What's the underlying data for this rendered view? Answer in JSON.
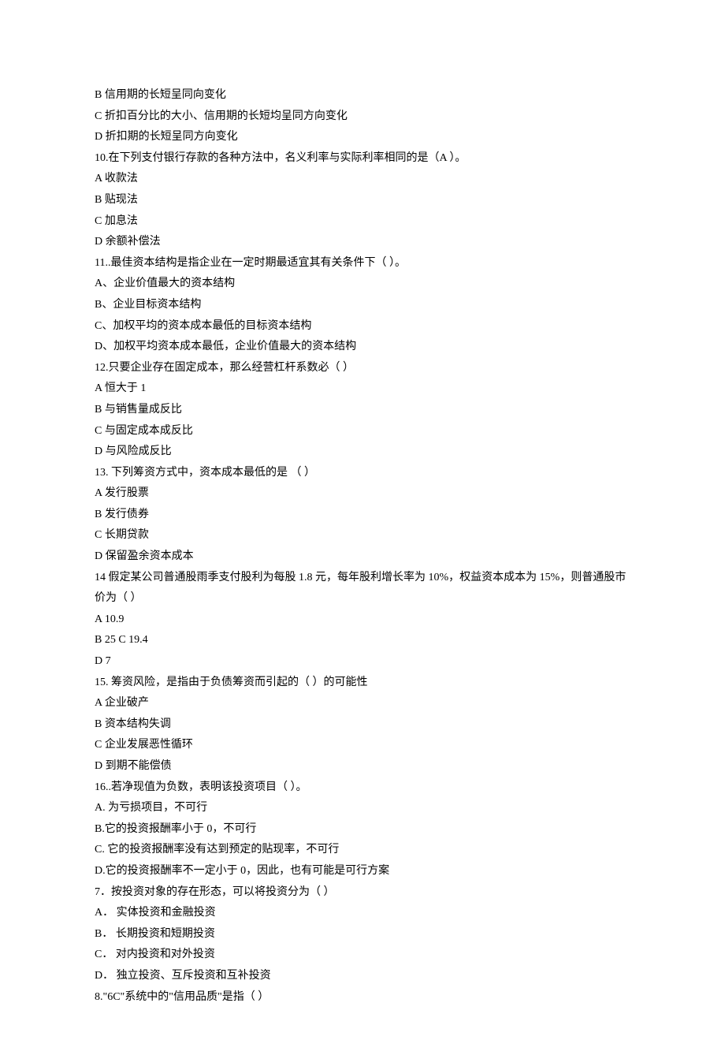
{
  "lines": [
    "B 信用期的长短呈同向变化",
    "C 折扣百分比的大小、信用期的长短均呈同方向变化",
    "D 折扣期的长短呈同方向变化",
    "10.在下列支付银行存款的各种方法中，名义利率与实际利率相同的是（A ）。",
    "A 收款法",
    "B 贴现法",
    "C 加息法",
    "D 余额补偿法",
    "11..最佳资本结构是指企业在一定时期最适宜其有关条件下（ ）。",
    "A、企业价值最大的资本结构",
    "B、企业目标资本结构",
    "C、加权平均的资本成本最低的目标资本结构",
    "D、加权平均资本成本最低，企业价值最大的资本结构",
    "12.只要企业存在固定成本，那么经营杠杆系数必（ ）",
    "A 恒大于 1",
    "B 与销售量成反比",
    "C 与固定成本成反比",
    "D 与风险成反比",
    "13. 下列筹资方式中，资本成本最低的是 （ ）",
    "A 发行股票",
    "B 发行债券",
    "C 长期贷款",
    "D 保留盈余资本成本",
    "14 假定某公司普通股雨季支付股利为每股 1.8 元，每年股利增长率为 10%，权益资本成本为 15%，则普通股市价为（ ）",
    "A 10.9",
    "B 25 C 19.4",
    "D 7",
    "15. 筹资风险，是指由于负债筹资而引起的（ ）的可能性",
    "A 企业破产",
    "B 资本结构失调",
    "C 企业发展恶性循环",
    "D 到期不能偿债",
    "16..若净现值为负数，表明该投资项目（ ）。",
    "A. 为亏损项目，不可行",
    "B.它的投资报酬率小于 0，不可行",
    "C. 它的投资报酬率没有达到预定的贴现率，不可行",
    "D.它的投资报酬率不一定小于 0，因此，也有可能是可行方案",
    "7．按投资对象的存在形态，可以将投资分为（ ）",
    "A．  实体投资和金融投资",
    "B．  长期投资和短期投资",
    "C．  对内投资和对外投资",
    "D．  独立投资、互斥投资和互补投资",
    "8.\"6C\"系统中的\"信用品质\"是指（ ）"
  ]
}
